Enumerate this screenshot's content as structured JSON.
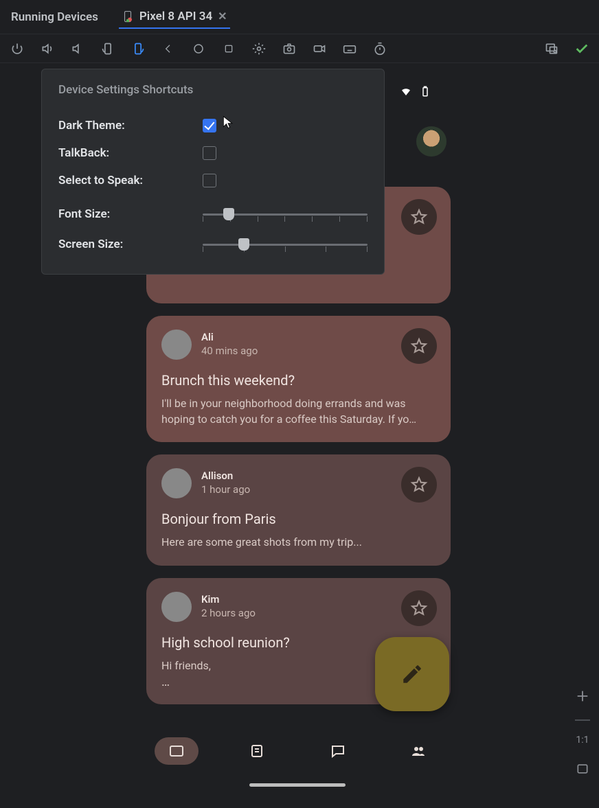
{
  "tabs": {
    "running_devices": "Running Devices",
    "device_tab": "Pixel 8 API 34"
  },
  "popup": {
    "title": "Device Settings Shortcuts",
    "dark_theme_label": "Dark Theme:",
    "dark_theme_checked": true,
    "talkback_label": "TalkBack:",
    "talkback_checked": false,
    "select_to_speak_label": "Select to Speak:",
    "select_to_speak_checked": false,
    "font_size_label": "Font Size:",
    "font_size_value": 1,
    "font_size_ticks": 7,
    "screen_size_label": "Screen Size:",
    "screen_size_value": 1,
    "screen_size_ticks": 5
  },
  "toolbar_icons": [
    "power",
    "volume-up",
    "volume-down",
    "rotate-portrait",
    "rotate-landscape",
    "back",
    "home",
    "overview",
    "settings-gear",
    "camera",
    "video",
    "keyboard",
    "timer"
  ],
  "toolbar_right": [
    "resize-icon",
    "checkmark"
  ],
  "gutter": {
    "plus": "+",
    "ratio_label": "1:1"
  },
  "device": {
    "emails": [
      {
        "sender": "",
        "time": "",
        "subject": "",
        "body": "",
        "truncated": true,
        "featured": true,
        "avatar_class": "av1"
      },
      {
        "sender": "Ali",
        "time": "40 mins ago",
        "subject": "Brunch this weekend?",
        "body": "I'll be in your neighborhood doing errands and was hoping to catch you for a coffee this Saturday. If yo…",
        "truncated": false,
        "featured": true,
        "avatar_class": "av2"
      },
      {
        "sender": "Allison",
        "time": "1 hour ago",
        "subject": "Bonjour from Paris",
        "body": "Here are some great shots from my trip...",
        "truncated": false,
        "featured": false,
        "avatar_class": "av3"
      },
      {
        "sender": "Kim",
        "time": "2 hours ago",
        "subject": "High school reunion?",
        "body": "Hi friends,",
        "ellips": "…",
        "truncated": false,
        "featured": false,
        "avatar_class": "av4"
      }
    ],
    "nav_items": [
      "inbox",
      "articles",
      "chat",
      "people"
    ],
    "nav_selected": 0
  }
}
